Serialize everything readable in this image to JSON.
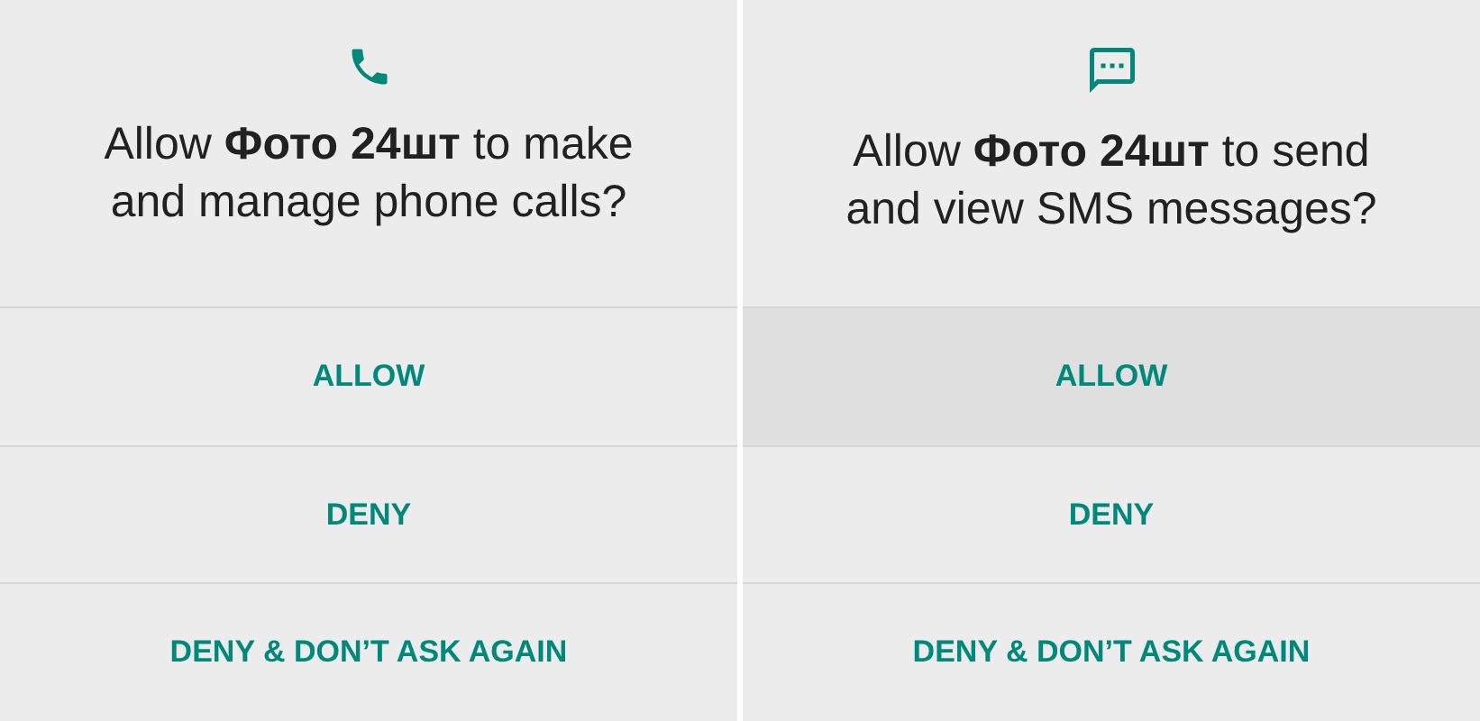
{
  "dialogs": [
    {
      "kind": "phone",
      "message": "Allow **Фото 24шт** to make and manage phone calls?",
      "buttons": [
        {
          "label": "ALLOW",
          "highlighted": false
        },
        {
          "label": "DENY",
          "highlighted": false
        },
        {
          "label": "DENY & DON’T ASK AGAIN",
          "highlighted": false
        }
      ]
    },
    {
      "kind": "sms",
      "message": "Allow **Фото 24шт** to send and view SMS messages?",
      "buttons": [
        {
          "label": "ALLOW",
          "highlighted": true
        },
        {
          "label": "DENY",
          "highlighted": false
        },
        {
          "label": "DENY & DON’T ASK AGAIN",
          "highlighted": false
        }
      ]
    }
  ]
}
